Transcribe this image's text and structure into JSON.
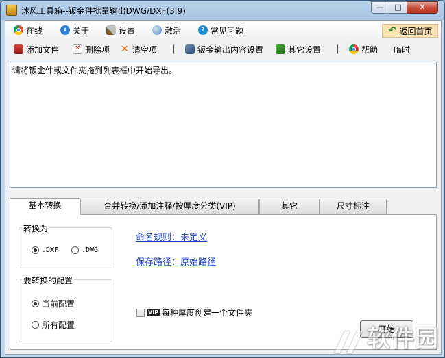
{
  "window": {
    "title": "沐风工具箱--钣金件批量输出DWG/DXF(3.9)",
    "controls": {
      "minimize": "—",
      "maximize": "□",
      "close": "✕"
    }
  },
  "toolbar1": {
    "online": "在线",
    "about": "关于",
    "settings": "设置",
    "activate": "激活",
    "faq": "常见问题",
    "home": "返回首页"
  },
  "toolbar2": {
    "add_file": "添加文件",
    "delete_item": "删除项",
    "clear_items": "清空项",
    "sheet_output_settings": "钣金输出内容设置",
    "other_settings": "其它设置",
    "help": "帮助",
    "temp": "临时"
  },
  "list": {
    "hint": "请将钣金件或文件夹拖到列表框中开始导出。"
  },
  "tabs": [
    {
      "label": "基本转换",
      "active": true
    },
    {
      "label": "合并转换/添加注释/按厚度分类(VIP)",
      "active": false
    },
    {
      "label": "其它",
      "active": false
    },
    {
      "label": "尺寸标注",
      "active": false
    }
  ],
  "basic": {
    "convert_to": {
      "title": "转换为",
      "options": [
        ".DXF",
        ".DWG"
      ],
      "selected": ".DXF"
    },
    "config": {
      "title": "要转换的配置",
      "options": [
        "当前配置",
        "所有配置"
      ],
      "selected": "当前配置"
    },
    "naming_rule_label": "命名规则：",
    "naming_rule_value": "未定义",
    "save_path_label": "保存路径：",
    "save_path_value": "原始路径",
    "vip_badge": "VIP",
    "folder_per_thickness": "每种厚度创建一个文件夹",
    "folder_per_thickness_checked": false,
    "start_button": "开始"
  },
  "watermark": "软件园",
  "colors": {
    "link": "#1f45c9",
    "home_bg": "#fbe3b6",
    "titlebar": "#b9d1ea"
  }
}
